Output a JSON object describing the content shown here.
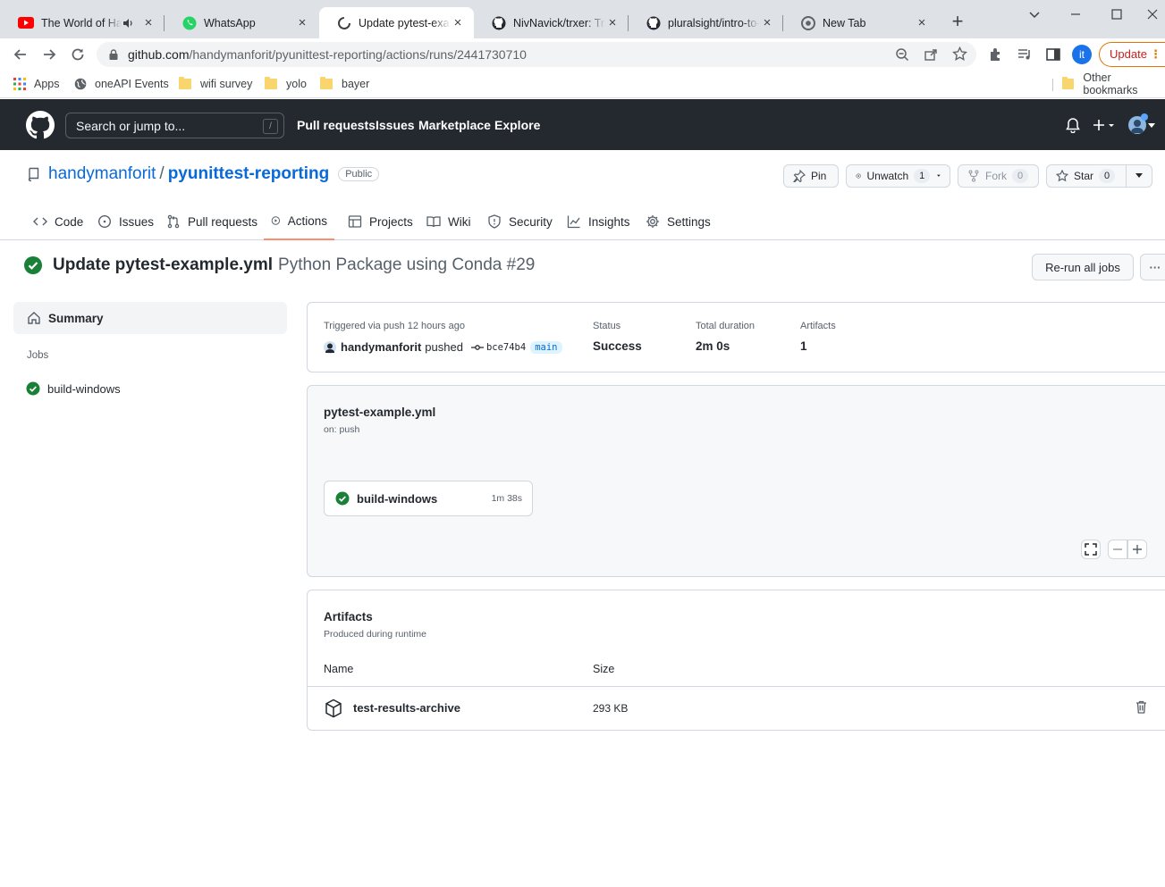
{
  "browser": {
    "tabs": [
      {
        "title": "The World of Ha"
      },
      {
        "title": "WhatsApp"
      },
      {
        "title": "Update pytest-exam"
      },
      {
        "title": "NivNavick/trxer: Tran"
      },
      {
        "title": "pluralsight/intro-to-p"
      },
      {
        "title": "New Tab"
      }
    ],
    "url_host": "github.com",
    "url_path": "/handymanforit/pyunittest-reporting/actions/runs/2441730710",
    "profile_initials": "it",
    "update_label": "Update",
    "bookmarks": [
      {
        "label": "Apps"
      },
      {
        "label": "oneAPI Events"
      },
      {
        "label": "wifi survey"
      },
      {
        "label": "yolo"
      },
      {
        "label": "bayer"
      }
    ],
    "other_bookmarks": "Other bookmarks"
  },
  "github": {
    "search_placeholder": "Search or jump to...",
    "search_shortcut": "/",
    "nav": [
      "Pull requests",
      "Issues",
      "Marketplace",
      "Explore"
    ]
  },
  "repo": {
    "owner": "handymanforit",
    "slash": "/",
    "name": "pyunittest-reporting",
    "visibility": "Public",
    "pin_label": "Pin",
    "unwatch_label": "Unwatch",
    "watch_count": "1",
    "fork_label": "Fork",
    "fork_count": "0",
    "star_label": "Star",
    "star_count": "0",
    "tabs": [
      "Code",
      "Issues",
      "Pull requests",
      "Actions",
      "Projects",
      "Wiki",
      "Security",
      "Insights",
      "Settings"
    ]
  },
  "run": {
    "commit_title": "Update pytest-example.yml",
    "workflow_label": "Python Package using Conda #29",
    "rerun_label": "Re-run all jobs",
    "more_label": "···"
  },
  "sidebar": {
    "summary_label": "Summary",
    "jobs_label": "Jobs",
    "job": "build-windows"
  },
  "summary": {
    "triggered_label": "Triggered via push 12 hours ago",
    "actor": "handymanforit",
    "action": "pushed",
    "sha": "bce74b4",
    "branch": "main",
    "status_label": "Status",
    "status_value": "Success",
    "duration_label": "Total duration",
    "duration_value": "2m 0s",
    "artifacts_label": "Artifacts",
    "artifacts_value": "1"
  },
  "workflow": {
    "file": "pytest-example.yml",
    "trigger": "on: push",
    "job_name": "build-windows",
    "job_duration": "1m 38s"
  },
  "artifacts": {
    "title": "Artifacts",
    "subtitle": "Produced during runtime",
    "col_name": "Name",
    "col_size": "Size",
    "items": [
      {
        "name": "test-results-archive",
        "size": "293 KB"
      }
    ]
  },
  "colors": {
    "success": "#1a7f37",
    "link": "#0969da",
    "header_bg": "#24292f",
    "active_tab_underline": "#fd8c73"
  }
}
